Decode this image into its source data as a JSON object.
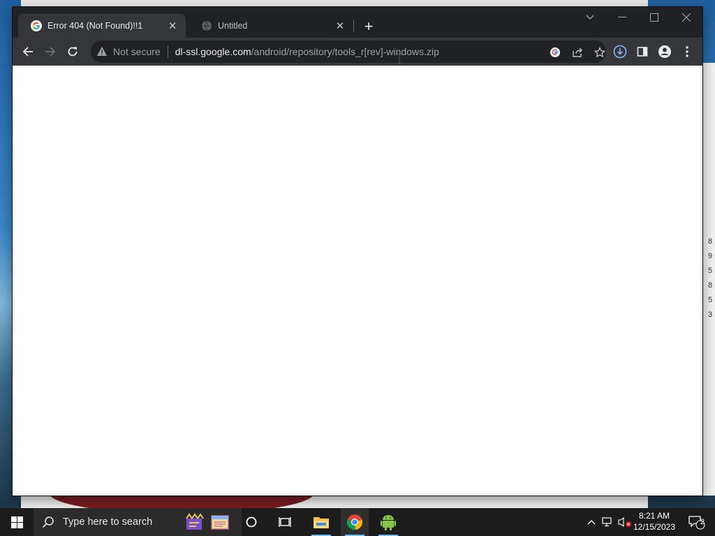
{
  "browser": {
    "tabs": [
      {
        "title": "Error 404 (Not Found)!!1",
        "favicon": "google-g-icon",
        "active": true
      },
      {
        "title": "Untitled",
        "favicon": "globe-icon",
        "active": false
      }
    ],
    "omnibox": {
      "security_label": "Not secure",
      "host": "dl-ssl.google.com",
      "path": "/android/repository/tools_r[rev]-windows.zip"
    },
    "toolbar_icons": [
      "back-icon",
      "forward-icon",
      "reload-icon",
      "google-lens-icon",
      "share-icon",
      "bookmark-star-icon",
      "download-icon",
      "side-panel-icon",
      "profile-icon",
      "menu-icon"
    ]
  },
  "taskbar": {
    "search_placeholder": "Type here to search",
    "clock_time": "8:21 AM",
    "clock_date": "12/15/2023",
    "notification_count": "2",
    "pinned": [
      "start-icon",
      "search-icon",
      "movie-maker-icon",
      "notepad-icon",
      "cortana-icon",
      "task-view-icon",
      "file-explorer-icon",
      "chrome-icon",
      "android-studio-icon"
    ],
    "tray": [
      "chevron-up-icon",
      "network-icon",
      "volume-muted-icon"
    ]
  },
  "colors": {
    "chrome_frame": "#202124",
    "chrome_toolbar": "#35363a",
    "taskbar": "#1c1c1c",
    "accent": "#8ab4f8"
  }
}
